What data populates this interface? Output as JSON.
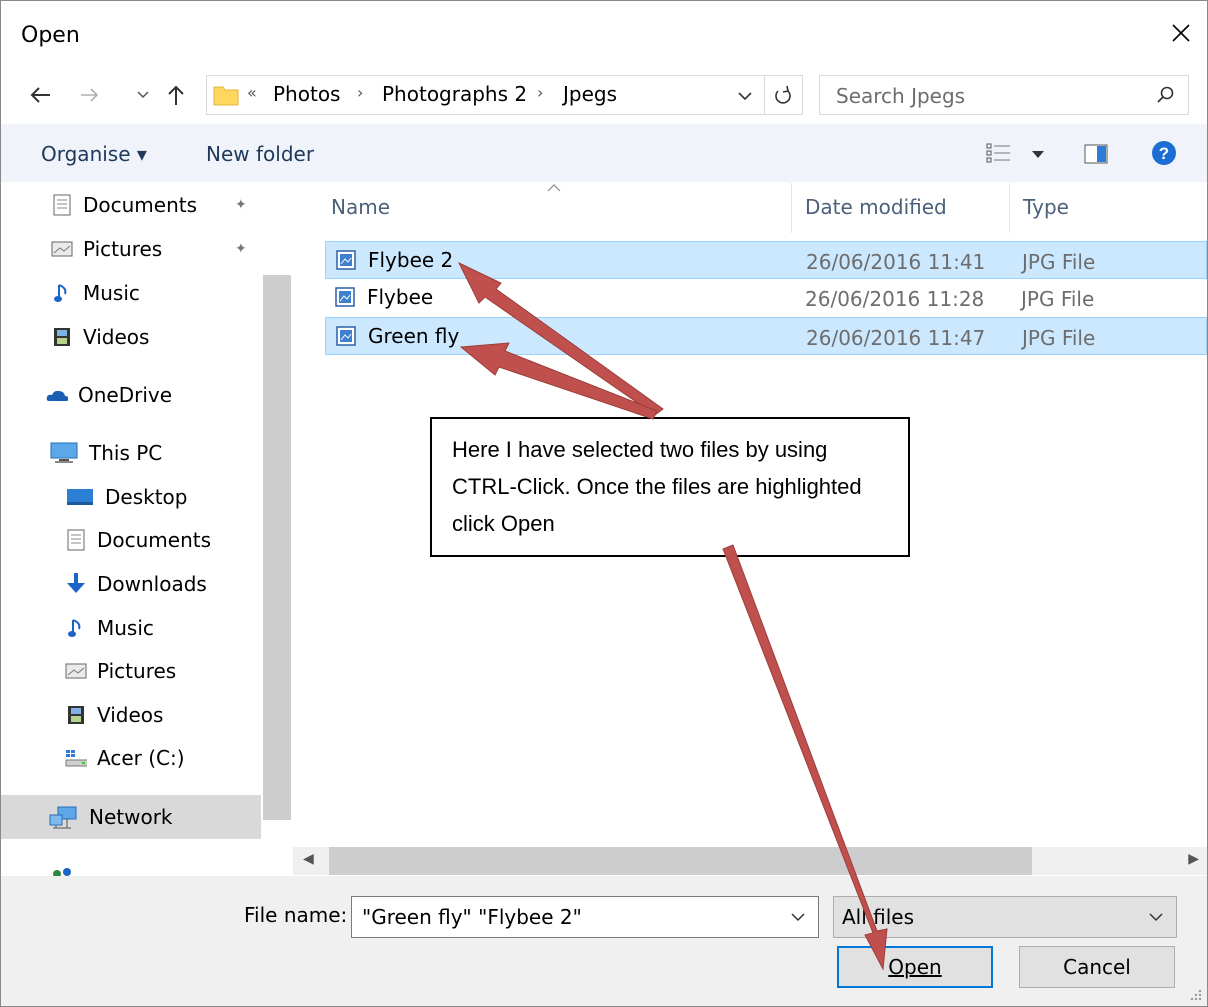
{
  "window": {
    "title": "Open"
  },
  "address": {
    "prefix": "«",
    "crumbs": [
      "Photos",
      "Photographs 2",
      "Jpegs"
    ],
    "separator": "›"
  },
  "search": {
    "placeholder": "Search Jpegs"
  },
  "toolbar": {
    "organise": "Organise ▾",
    "new_folder": "New folder"
  },
  "sidebar": {
    "items": [
      {
        "label": "Documents",
        "icon": "documents-icon",
        "pinned": true
      },
      {
        "label": "Pictures",
        "icon": "pictures-icon",
        "pinned": true
      },
      {
        "label": "Music",
        "icon": "music-icon"
      },
      {
        "label": "Videos",
        "icon": "videos-icon"
      },
      {
        "label": "OneDrive",
        "icon": "onedrive-icon"
      },
      {
        "label": "This PC",
        "icon": "this-pc-icon"
      },
      {
        "label": "Desktop",
        "icon": "desktop-icon"
      },
      {
        "label": "Documents",
        "icon": "documents-icon"
      },
      {
        "label": "Downloads",
        "icon": "downloads-icon"
      },
      {
        "label": "Music",
        "icon": "music-icon"
      },
      {
        "label": "Pictures",
        "icon": "pictures-icon"
      },
      {
        "label": "Videos",
        "icon": "videos-icon"
      },
      {
        "label": "Acer (C:)",
        "icon": "drive-icon"
      },
      {
        "label": "Network",
        "icon": "network-icon",
        "selected": true
      }
    ]
  },
  "columns": {
    "name": "Name",
    "date": "Date modified",
    "type": "Type"
  },
  "files": [
    {
      "name": "Flybee 2",
      "date": "26/06/2016 11:41",
      "type": "JPG File",
      "selected": true
    },
    {
      "name": "Flybee",
      "date": "26/06/2016 11:28",
      "type": "JPG File",
      "selected": false
    },
    {
      "name": "Green fly",
      "date": "26/06/2016 11:47",
      "type": "JPG File",
      "selected": true
    }
  ],
  "footer": {
    "file_name_label": "File name:",
    "file_name_value": "\"Green fly\" \"Flybee 2\"",
    "filter_value": "All files",
    "open_label": "Open",
    "cancel_label": "Cancel"
  },
  "callout": {
    "text": "Here I have selected two files by using CTRL-Click. Once the files are highlighted click Open"
  },
  "colors": {
    "selection": "#cce8ff",
    "arrow": "#c0504d",
    "accent": "#0078d7"
  }
}
